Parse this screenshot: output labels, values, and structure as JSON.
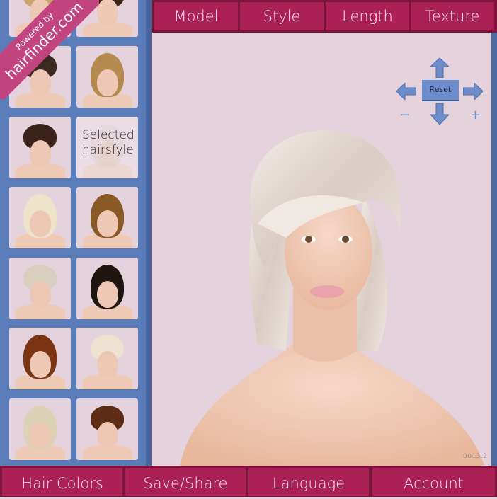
{
  "brand": {
    "ribbon_line1": "Powered by",
    "ribbon_line2": "hairfinder.com",
    "ribbon_color": "#c2457f"
  },
  "top_nav": {
    "items": [
      {
        "label": "Model"
      },
      {
        "label": "Style"
      },
      {
        "label": "Length"
      },
      {
        "label": "Texture"
      }
    ]
  },
  "bottom_nav": {
    "items": [
      {
        "label": "Hair Colors"
      },
      {
        "label": "Save/Share"
      },
      {
        "label": "Language"
      },
      {
        "label": "Account"
      }
    ]
  },
  "sidebar": {
    "thumbnails": [
      {
        "hair": "blonde-updo",
        "hair_color": "#c9a66b"
      },
      {
        "hair": "dark-bob-fringe",
        "hair_color": "#3a2418"
      },
      {
        "hair": "short-pixie-dark",
        "hair_color": "#3b2a20"
      },
      {
        "hair": "long-wavy-blonde-highlights",
        "hair_color": "#b58a4e"
      },
      {
        "hair": "short-bob-dark-brown",
        "hair_color": "#3a2218"
      },
      {
        "hair": "selected",
        "hair_color": "#d9cfcc",
        "selected_label": "Selected hairsfyle"
      },
      {
        "hair": "medium-curly-platinum",
        "hair_color": "#ece3c8"
      },
      {
        "hair": "long-wavy-caramel",
        "hair_color": "#8a5a26"
      },
      {
        "hair": "platinum-bowl-cut",
        "hair_color": "#d8cfc0"
      },
      {
        "hair": "short-curly-black",
        "hair_color": "#1f1612"
      },
      {
        "hair": "curly-auburn-bob",
        "hair_color": "#7a3414"
      },
      {
        "hair": "platinum-side-swept-pixie",
        "hair_color": "#ece2cf"
      },
      {
        "hair": "short-curly-blonde",
        "hair_color": "#dcd2b6"
      },
      {
        "hair": "auburn-pixie",
        "hair_color": "#5e2c16"
      }
    ]
  },
  "stage": {
    "model_hair": "platinum-layered-side-fringe",
    "version": "0013.2"
  },
  "controls": {
    "reset_label": "Reset",
    "minus_label": "−",
    "plus_label": "+"
  },
  "colors": {
    "nav_button": "#ab2156",
    "sidebar": "#5a7cb9",
    "background": "#e4d2dc",
    "control_blue": "#6d8ccb"
  }
}
